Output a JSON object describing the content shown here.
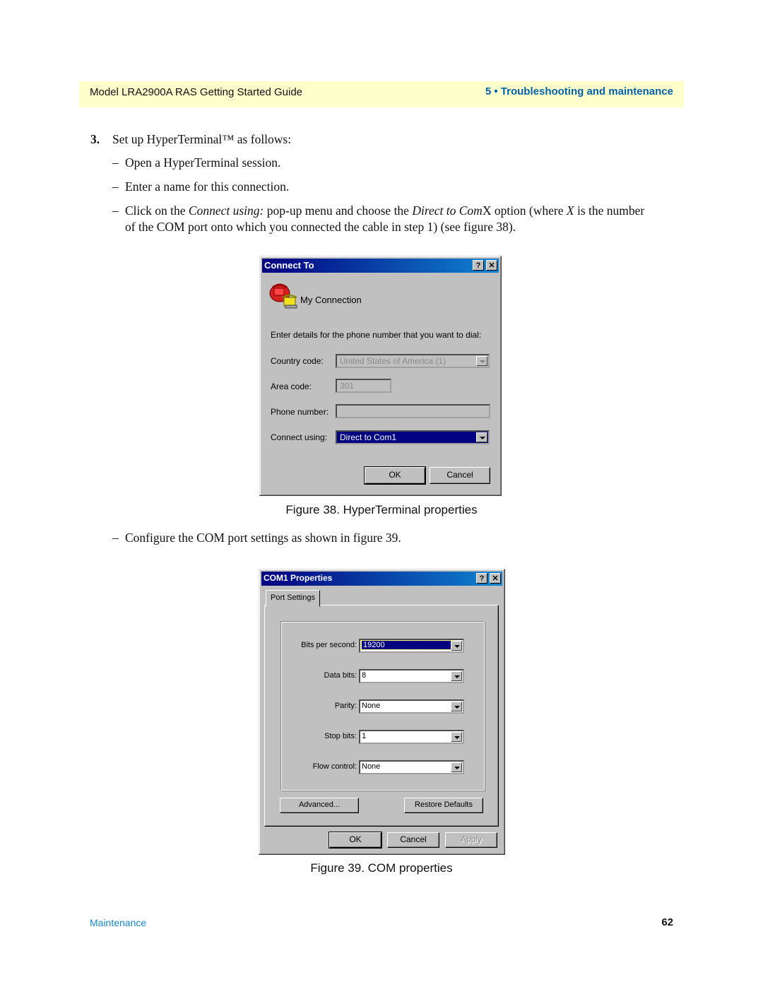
{
  "header": {
    "guide_title": "Model LRA2900A RAS Getting Started Guide",
    "chapter": "5 • Troubleshooting and maintenance"
  },
  "content": {
    "step_number": "3.",
    "step_text": "Set up HyperTerminal™ as follows:",
    "bullets": [
      "Open a HyperTerminal session.",
      "Enter a name for this connection.",
      {
        "pre1": "Click on the ",
        "em1": "Connect using:",
        "mid1": " pop-up menu and choose the ",
        "em2": "Direct to Com",
        "mid2": "X option (where ",
        "em3": "X",
        "post": " is the number",
        "cont": "of the COM port onto which you connected the cable in step 1) (see figure 38)."
      },
      "Configure the COM port settings as shown in figure 39."
    ],
    "dash": "–"
  },
  "figure38": {
    "caption": "Figure 38. HyperTerminal properties",
    "dialog": {
      "title": "Connect To",
      "help_button": "?",
      "close_button": "✕",
      "connection_name": "My Connection",
      "instruction": "Enter details for the phone number that you want to dial:",
      "country_code_label": "Country code:",
      "country_code_value": "United States of America (1)",
      "area_code_label": "Area code:",
      "area_code_value": "301",
      "phone_number_label": "Phone number:",
      "phone_number_value": "",
      "connect_using_label": "Connect using:",
      "connect_using_value": "Direct to Com1",
      "ok": "OK",
      "cancel": "Cancel"
    }
  },
  "figure39": {
    "caption": "Figure 39. COM properties",
    "dialog": {
      "title": "COM1 Properties",
      "help_button": "?",
      "close_button": "✕",
      "tab": "Port Settings",
      "fields": [
        {
          "label": "Bits per second:",
          "value": "19200"
        },
        {
          "label": "Data bits:",
          "value": "8"
        },
        {
          "label": "Parity:",
          "value": "None"
        },
        {
          "label": "Stop bits:",
          "value": "1"
        },
        {
          "label": "Flow control:",
          "value": "None"
        }
      ],
      "advanced": "Advanced...",
      "restore_defaults": "Restore Defaults",
      "ok": "OK",
      "cancel": "Cancel",
      "apply": "Apply"
    }
  },
  "footer": {
    "section": "Maintenance",
    "page_number": "62"
  }
}
